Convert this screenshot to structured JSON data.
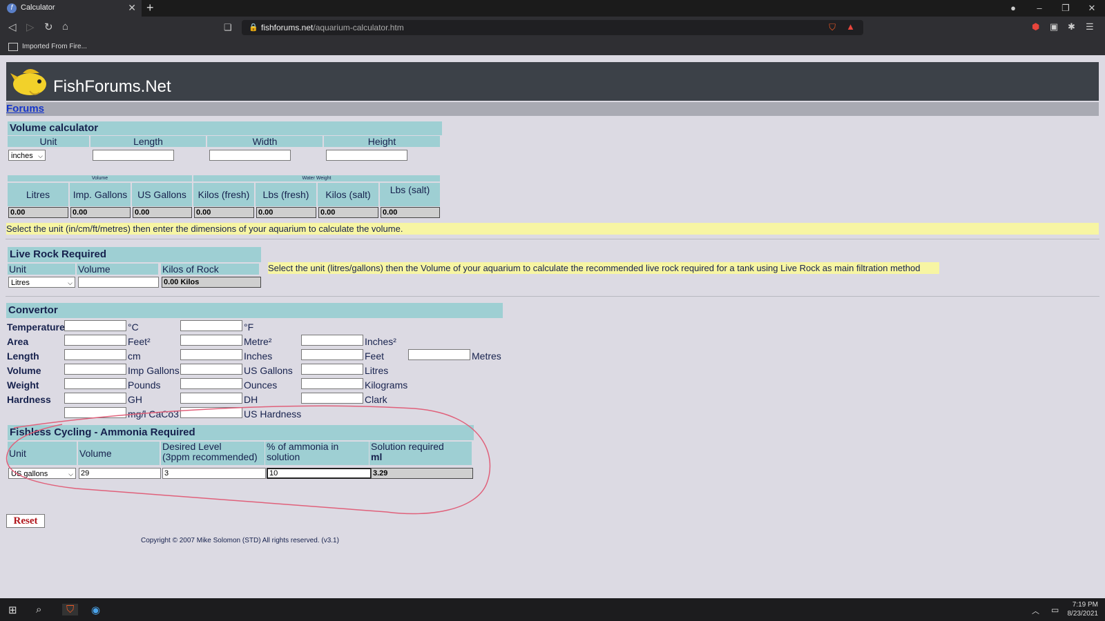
{
  "browser": {
    "tab_title": "Calculator",
    "url_host": "fishforums.net",
    "url_path": "/aquarium-calculator.htm",
    "bookmark": "Imported From Fire..."
  },
  "site": {
    "logo_text": "FishForums.Net",
    "forums_link": "Forums"
  },
  "volume": {
    "title": "Volume calculator",
    "headers": [
      "Unit",
      "Length",
      "Width",
      "Height"
    ],
    "unit_selected": "inches",
    "group_volume": "Volume",
    "group_weight": "Water Weight",
    "result_headers": [
      "Litres",
      "Imp. Gallons",
      "US Gallons",
      "Kilos (fresh)",
      "Lbs (fresh)",
      "Kilos (salt)",
      "Lbs (salt)"
    ],
    "results": [
      "0.00",
      "0.00",
      "0.00",
      "0.00",
      "0.00",
      "0.00",
      "0.00"
    ],
    "note": "Select the unit (in/cm/ft/metres) then enter the dimensions of your aquarium to calculate the volume."
  },
  "liverock": {
    "title": "Live Rock Required",
    "headers": [
      "Unit",
      "Volume",
      "Kilos of Rock"
    ],
    "unit_selected": "Litres",
    "result": "0.00 Kilos",
    "note": "Select the unit (litres/gallons) then the Volume of your aquarium to calculate the recommended live rock required for a tank using Live Rock as main filtration method"
  },
  "convertor": {
    "title": "Convertor",
    "rows": [
      {
        "label": "Temperature",
        "units": [
          "°C",
          "°F"
        ]
      },
      {
        "label": "Area",
        "units": [
          "Feet²",
          "Metre²",
          "Inches²"
        ]
      },
      {
        "label": "Length",
        "units": [
          "cm",
          "Inches",
          "Feet",
          "Metres"
        ]
      },
      {
        "label": "Volume",
        "units": [
          "Imp Gallons",
          "US Gallons",
          "Litres"
        ]
      },
      {
        "label": "Weight",
        "units": [
          "Pounds",
          "Ounces",
          "Kilograms"
        ]
      },
      {
        "label": "Hardness",
        "units": [
          "GH",
          "DH",
          "Clark"
        ]
      },
      {
        "label": "",
        "units": [
          "mg/l CaCo3",
          "US Hardness"
        ]
      }
    ]
  },
  "fishless": {
    "title": "Fishless Cycling - Ammonia Required",
    "headers": [
      "Unit",
      "Volume",
      "Desired Level",
      "% of ammonia in",
      "Solution required"
    ],
    "headers_line2": [
      "",
      "",
      "(3ppm recommended)",
      "solution",
      "ml"
    ],
    "unit_selected": "US gallons",
    "volume": "29",
    "desired": "3",
    "percent": "10",
    "result": "3.29"
  },
  "reset_label": "Reset",
  "copyright": "Copyright © 2007 Mike Solomon (STD) All rights reserved. (v3.1)",
  "clock": {
    "time": "7:19 PM",
    "date": "8/23/2021"
  },
  "colors": {
    "accent_teal": "#9ecfd3",
    "note_yellow": "#f7f5a3",
    "header_text": "#16214d",
    "annotation_red": "#e0607a"
  }
}
